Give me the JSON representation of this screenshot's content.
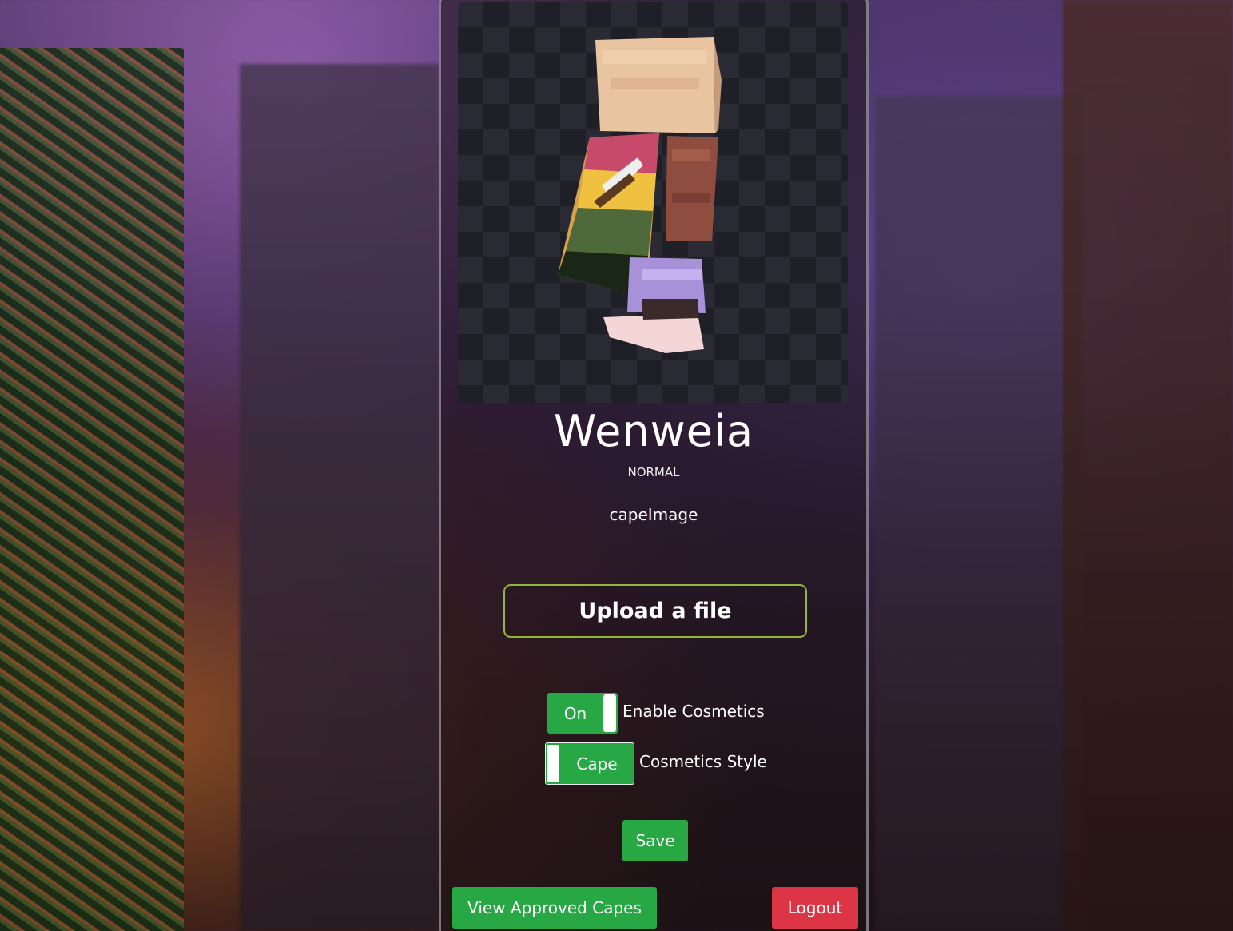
{
  "profile": {
    "username": "Wenweia",
    "rank": "NORMAL",
    "cape_image_label": "capeImage"
  },
  "upload": {
    "label": "Upload a file"
  },
  "settings": {
    "cosmetics_toggle": {
      "state_label": "On",
      "caption": "Enable Cosmetics",
      "enabled": true
    },
    "style_toggle": {
      "state_label": "Cape",
      "caption": "Cosmetics Style"
    }
  },
  "actions": {
    "save_label": "Save",
    "view_capes_label": "View Approved Capes",
    "logout_label": "Logout"
  },
  "colors": {
    "success": "#28a745",
    "danger": "#dc3545",
    "upload_border": "#8fb83a"
  }
}
